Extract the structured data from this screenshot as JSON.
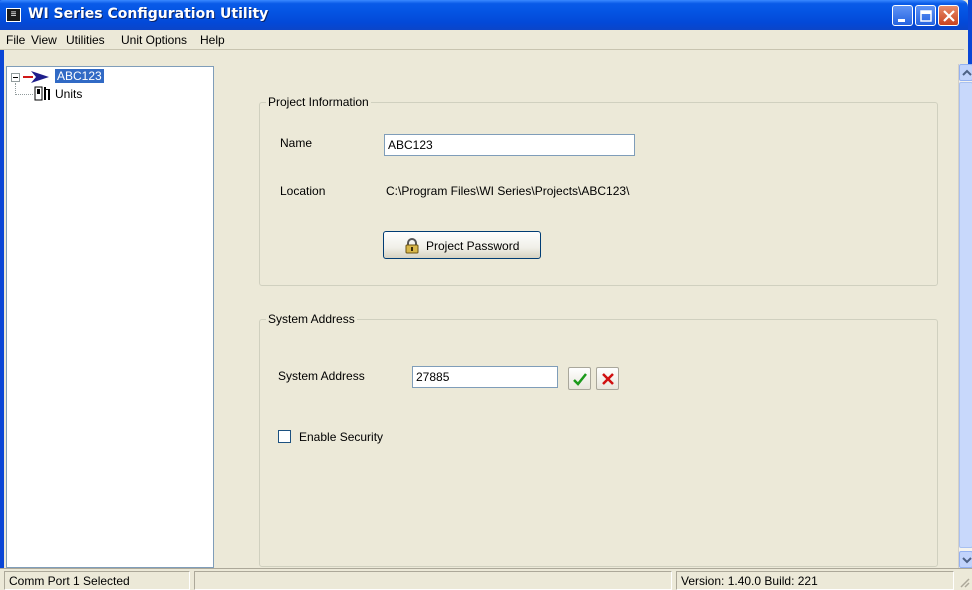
{
  "window": {
    "title": "WI Series Configuration Utility",
    "icon": "app-logo-icon"
  },
  "menubar": {
    "items": [
      "File",
      "View",
      "Utilities",
      "Unit Options",
      "Help"
    ]
  },
  "tree": {
    "root_label": "ABC123",
    "child_label": "Units"
  },
  "project_info": {
    "group_title": "Project Information",
    "name_label": "Name",
    "name_value": "ABC123",
    "location_label": "Location",
    "location_value": "C:\\Program Files\\WI Series\\Projects\\ABC123\\",
    "password_button": "Project Password"
  },
  "system_address": {
    "group_title": "System Address",
    "field_label": "System Address",
    "field_value": "27885",
    "enable_security_label": "Enable Security",
    "enable_security_checked": false
  },
  "statusbar": {
    "left": "Comm Port 1 Selected",
    "middle": "",
    "right": "Version: 1.40.0 Build: 221"
  },
  "colors": {
    "titlebar": "#0454e3",
    "selection": "#316ac5",
    "accept_icon": "#1b9a1b",
    "cancel_icon": "#d01010"
  }
}
